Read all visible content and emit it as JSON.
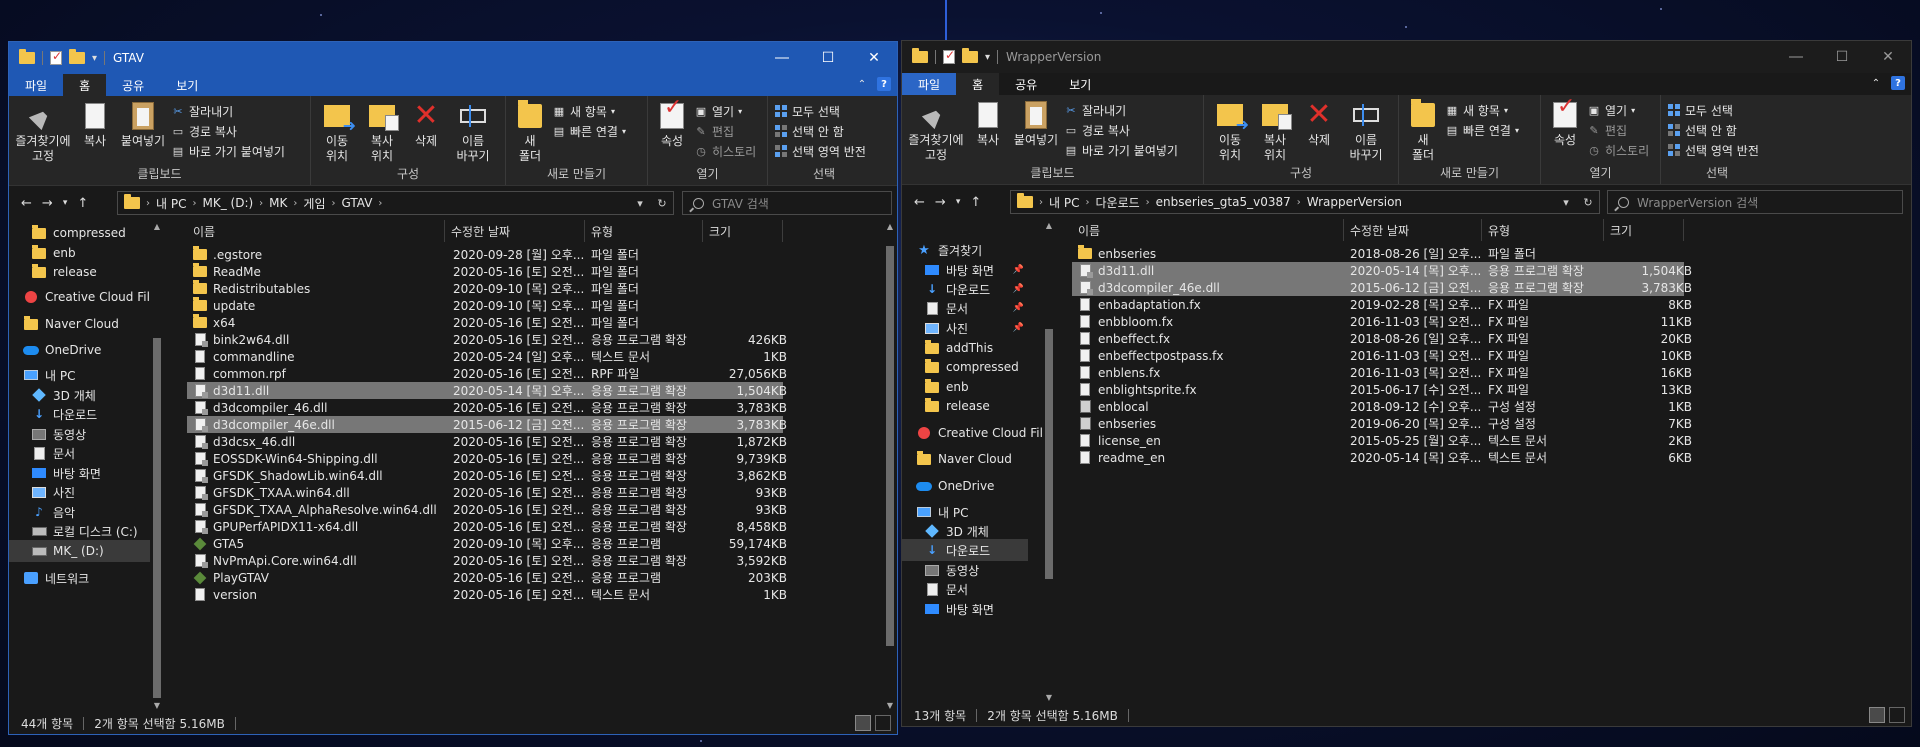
{
  "left": {
    "title": "GTAV",
    "tabs": [
      "파일",
      "홈",
      "공유",
      "보기"
    ],
    "active_tab": 1,
    "ribbon": {
      "clipboard": {
        "label": "클립보드",
        "pin": "즐겨찾기에\n고정",
        "copy": "복사",
        "paste": "붙여넣기",
        "cut": "잘라내기",
        "copy_path": "경로 복사",
        "paste_shortcut": "바로 가기 붙여넣기"
      },
      "organize": {
        "label": "구성",
        "move_to": "이동\n위치",
        "copy_to": "복사\n위치",
        "delete": "삭제",
        "rename": "이름\n바꾸기"
      },
      "new": {
        "label": "새로 만들기",
        "new_folder": "새\n폴더",
        "new_item": "새 항목",
        "easy_access": "빠른 연결"
      },
      "open": {
        "label": "열기",
        "properties": "속성",
        "open": "열기",
        "edit": "편집",
        "history": "히스토리"
      },
      "select": {
        "label": "선택",
        "select_all": "모두 선택",
        "select_none": "선택 안 함",
        "invert": "선택 영역 반전"
      }
    },
    "breadcrumb": [
      "내 PC",
      "MK_ (D:)",
      "MK",
      "게임",
      "GTAV"
    ],
    "search_placeholder": "GTAV 검색",
    "nav": [
      {
        "label": "compressed",
        "icon": "folder-icon"
      },
      {
        "label": "enb",
        "icon": "folder-icon"
      },
      {
        "label": "release",
        "icon": "folder-icon"
      },
      {
        "label": "Creative Cloud Fil",
        "icon": "creative-cloud-icon"
      },
      {
        "label": "Naver Cloud",
        "icon": "folder-icon"
      },
      {
        "label": "OneDrive",
        "icon": "onedrive-icon"
      },
      {
        "label": "내 PC",
        "icon": "pc-icon"
      },
      {
        "label": "3D 개체",
        "icon": "3d-objects-icon"
      },
      {
        "label": "다운로드",
        "icon": "downloads-icon"
      },
      {
        "label": "동영상",
        "icon": "videos-icon"
      },
      {
        "label": "문서",
        "icon": "documents-icon"
      },
      {
        "label": "바탕 화면",
        "icon": "desktop-icon"
      },
      {
        "label": "사진",
        "icon": "pictures-icon"
      },
      {
        "label": "음악",
        "icon": "music-icon"
      },
      {
        "label": "로컬 디스크 (C:)",
        "icon": "drive-icon"
      },
      {
        "label": "MK_ (D:)",
        "icon": "drive-icon",
        "selected": true
      },
      {
        "label": "네트워크",
        "icon": "network-icon"
      }
    ],
    "columns": [
      "이름",
      "수정한 날짜",
      "유형",
      "크기"
    ],
    "files": [
      {
        "name": ".egstore",
        "date": "2020-09-28 [월] 오후...",
        "type": "파일 폴더",
        "size": "",
        "icon": "folder-icon"
      },
      {
        "name": "ReadMe",
        "date": "2020-05-16 [토] 오전...",
        "type": "파일 폴더",
        "size": "",
        "icon": "folder-icon"
      },
      {
        "name": "Redistributables",
        "date": "2020-09-10 [목] 오후...",
        "type": "파일 폴더",
        "size": "",
        "icon": "folder-icon"
      },
      {
        "name": "update",
        "date": "2020-09-10 [목] 오후...",
        "type": "파일 폴더",
        "size": "",
        "icon": "folder-icon"
      },
      {
        "name": "x64",
        "date": "2020-05-16 [토] 오전...",
        "type": "파일 폴더",
        "size": "",
        "icon": "folder-icon"
      },
      {
        "name": "bink2w64.dll",
        "date": "2020-05-16 [토] 오전...",
        "type": "응용 프로그램 확장",
        "size": "426KB",
        "icon": "dll-icon"
      },
      {
        "name": "commandline",
        "date": "2020-05-24 [일] 오후...",
        "type": "텍스트 문서",
        "size": "1KB",
        "icon": "file-icon"
      },
      {
        "name": "common.rpf",
        "date": "2020-05-16 [토] 오전...",
        "type": "RPF 파일",
        "size": "27,056KB",
        "icon": "file-icon"
      },
      {
        "name": "d3d11.dll",
        "date": "2020-05-14 [목] 오후...",
        "type": "응용 프로그램 확장",
        "size": "1,504KB",
        "icon": "dll-icon",
        "selected": true
      },
      {
        "name": "d3dcompiler_46.dll",
        "date": "2020-05-16 [토] 오전...",
        "type": "응용 프로그램 확장",
        "size": "3,783KB",
        "icon": "dll-icon"
      },
      {
        "name": "d3dcompiler_46e.dll",
        "date": "2015-06-12 [금] 오전...",
        "type": "응용 프로그램 확장",
        "size": "3,783KB",
        "icon": "dll-icon",
        "selected": true
      },
      {
        "name": "d3dcsx_46.dll",
        "date": "2020-05-16 [토] 오전...",
        "type": "응용 프로그램 확장",
        "size": "1,872KB",
        "icon": "dll-icon"
      },
      {
        "name": "EOSSDK-Win64-Shipping.dll",
        "date": "2020-05-16 [토] 오전...",
        "type": "응용 프로그램 확장",
        "size": "9,739KB",
        "icon": "dll-icon"
      },
      {
        "name": "GFSDK_ShadowLib.win64.dll",
        "date": "2020-05-16 [토] 오전...",
        "type": "응용 프로그램 확장",
        "size": "3,862KB",
        "icon": "dll-icon"
      },
      {
        "name": "GFSDK_TXAA.win64.dll",
        "date": "2020-05-16 [토] 오전...",
        "type": "응용 프로그램 확장",
        "size": "93KB",
        "icon": "dll-icon"
      },
      {
        "name": "GFSDK_TXAA_AlphaResolve.win64.dll",
        "date": "2020-05-16 [토] 오전...",
        "type": "응용 프로그램 확장",
        "size": "93KB",
        "icon": "dll-icon"
      },
      {
        "name": "GPUPerfAPIDX11-x64.dll",
        "date": "2020-05-16 [토] 오전...",
        "type": "응용 프로그램 확장",
        "size": "8,458KB",
        "icon": "dll-icon"
      },
      {
        "name": "GTA5",
        "date": "2020-09-10 [목] 오후...",
        "type": "응용 프로그램",
        "size": "59,174KB",
        "icon": "gta-icon"
      },
      {
        "name": "NvPmApi.Core.win64.dll",
        "date": "2020-05-16 [토] 오전...",
        "type": "응용 프로그램 확장",
        "size": "3,592KB",
        "icon": "dll-icon"
      },
      {
        "name": "PlayGTAV",
        "date": "2020-05-16 [토] 오전...",
        "type": "응용 프로그램",
        "size": "203KB",
        "icon": "gta-icon"
      },
      {
        "name": "version",
        "date": "2020-05-16 [토] 오전...",
        "type": "텍스트 문서",
        "size": "1KB",
        "icon": "file-icon"
      }
    ],
    "status": {
      "count": "44개 항목",
      "selected": "2개 항목 선택함 5.16MB"
    }
  },
  "right": {
    "title": "WrapperVersion",
    "tabs": [
      "파일",
      "홈",
      "공유",
      "보기"
    ],
    "active_tab": 1,
    "breadcrumb": [
      "내 PC",
      "다운로드",
      "enbseries_gta5_v0387",
      "WrapperVersion"
    ],
    "search_placeholder": "WrapperVersion 검색",
    "nav": [
      {
        "label": "즐겨찾기",
        "icon": "star-icon"
      },
      {
        "label": "바탕 화면",
        "icon": "desktop-icon",
        "pinned": true
      },
      {
        "label": "다운로드",
        "icon": "downloads-icon",
        "pinned": true
      },
      {
        "label": "문서",
        "icon": "documents-icon",
        "pinned": true
      },
      {
        "label": "사진",
        "icon": "pictures-icon",
        "pinned": true
      },
      {
        "label": "addThis",
        "icon": "folder-icon"
      },
      {
        "label": "compressed",
        "icon": "folder-icon"
      },
      {
        "label": "enb",
        "icon": "folder-icon"
      },
      {
        "label": "release",
        "icon": "folder-icon"
      },
      {
        "label": "Creative Cloud Fil",
        "icon": "creative-cloud-icon"
      },
      {
        "label": "Naver Cloud",
        "icon": "folder-icon"
      },
      {
        "label": "OneDrive",
        "icon": "onedrive-icon"
      },
      {
        "label": "내 PC",
        "icon": "pc-icon"
      },
      {
        "label": "3D 개체",
        "icon": "3d-objects-icon"
      },
      {
        "label": "다운로드",
        "icon": "downloads-icon",
        "selected": true
      },
      {
        "label": "동영상",
        "icon": "videos-icon"
      },
      {
        "label": "문서",
        "icon": "documents-icon"
      },
      {
        "label": "바탕 화면",
        "icon": "desktop-icon"
      }
    ],
    "columns": [
      "이름",
      "수정한 날짜",
      "유형",
      "크기"
    ],
    "files": [
      {
        "name": "enbseries",
        "date": "2018-08-26 [일] 오후...",
        "type": "파일 폴더",
        "size": "",
        "icon": "folder-icon"
      },
      {
        "name": "d3d11.dll",
        "date": "2020-05-14 [목] 오후...",
        "type": "응용 프로그램 확장",
        "size": "1,504KB",
        "icon": "dll-icon",
        "selected": true
      },
      {
        "name": "d3dcompiler_46e.dll",
        "date": "2015-06-12 [금] 오전...",
        "type": "응용 프로그램 확장",
        "size": "3,783KB",
        "icon": "dll-icon",
        "selected": true
      },
      {
        "name": "enbadaptation.fx",
        "date": "2019-02-28 [목] 오후...",
        "type": "FX 파일",
        "size": "8KB",
        "icon": "file-icon"
      },
      {
        "name": "enbbloom.fx",
        "date": "2016-11-03 [목] 오전...",
        "type": "FX 파일",
        "size": "11KB",
        "icon": "file-icon"
      },
      {
        "name": "enbeffect.fx",
        "date": "2018-08-26 [일] 오후...",
        "type": "FX 파일",
        "size": "20KB",
        "icon": "file-icon"
      },
      {
        "name": "enbeffectpostpass.fx",
        "date": "2016-11-03 [목] 오전...",
        "type": "FX 파일",
        "size": "10KB",
        "icon": "file-icon"
      },
      {
        "name": "enblens.fx",
        "date": "2016-11-03 [목] 오전...",
        "type": "FX 파일",
        "size": "16KB",
        "icon": "file-icon"
      },
      {
        "name": "enblightsprite.fx",
        "date": "2015-06-17 [수] 오전...",
        "type": "FX 파일",
        "size": "13KB",
        "icon": "file-icon"
      },
      {
        "name": "enblocal",
        "date": "2018-09-12 [수] 오후...",
        "type": "구성 설정",
        "size": "1KB",
        "icon": "config-icon"
      },
      {
        "name": "enbseries",
        "date": "2019-06-20 [목] 오후...",
        "type": "구성 설정",
        "size": "7KB",
        "icon": "config-icon"
      },
      {
        "name": "license_en",
        "date": "2015-05-25 [월] 오후...",
        "type": "텍스트 문서",
        "size": "2KB",
        "icon": "file-icon"
      },
      {
        "name": "readme_en",
        "date": "2020-05-14 [목] 오후...",
        "type": "텍스트 문서",
        "size": "6KB",
        "icon": "file-icon"
      }
    ],
    "status": {
      "count": "13개 항목",
      "selected": "2개 항목 선택함 5.16MB"
    }
  },
  "colors": {
    "folder": "#f3c54c",
    "active_titlebar": "#1f58b4",
    "selection": "#777777",
    "accent": "#2f73e0"
  }
}
